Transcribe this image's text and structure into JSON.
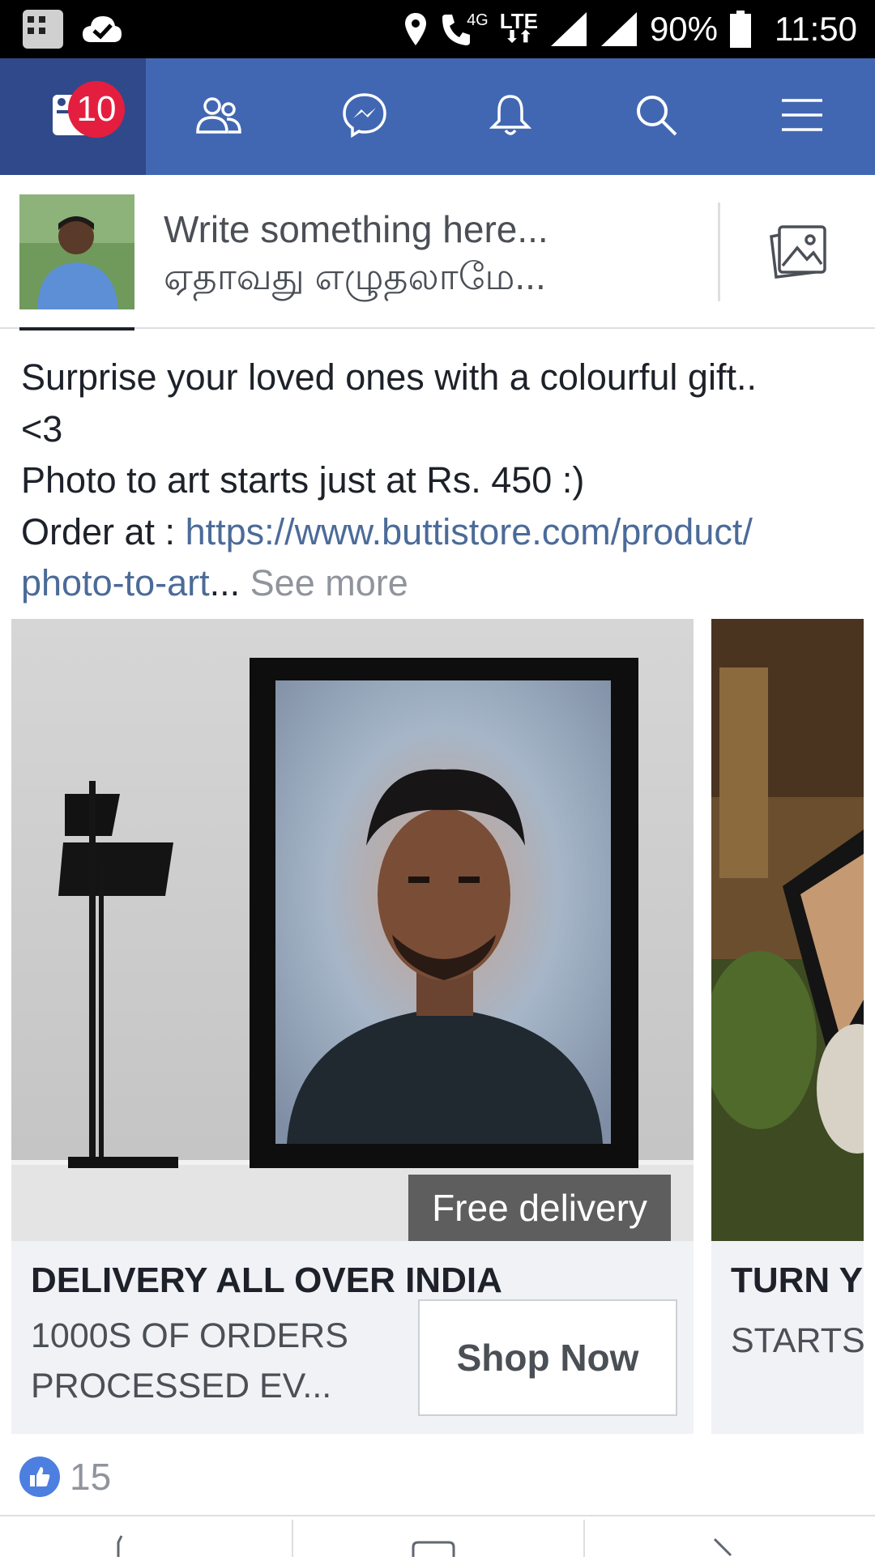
{
  "status_bar": {
    "network": "4G",
    "network_type": "LTE",
    "battery": "90%",
    "time": "11:50"
  },
  "nav": {
    "items": [
      {
        "icon": "news-feed-icon"
      },
      {
        "icon": "friends-icon"
      },
      {
        "icon": "messenger-icon"
      },
      {
        "icon": "bell-icon"
      },
      {
        "icon": "search-icon"
      },
      {
        "icon": "menu-icon"
      }
    ],
    "badge_count": "10"
  },
  "composer": {
    "line1": "Write something here...",
    "line2": "ஏதாவது எழுதலாமே..."
  },
  "post": {
    "line1": "Surprise your loved ones with a colourful gift..",
    "line2": "<3",
    "line3": "Photo to art starts just at Rs. 450 :)",
    "order_prefix": "Order at : ",
    "link_part1": "https://www.buttistore.com/product/",
    "link_part2": "photo-to-art",
    "ellipsis": "...",
    "see_more": "See more"
  },
  "carousel": [
    {
      "overlay": "Free delivery",
      "headline": "DELIVERY ALL OVER INDIA",
      "desc_line1": "1000S OF ORDERS",
      "desc_line2": "PROCESSED EV...",
      "cta": "Shop Now"
    },
    {
      "headline": "TURN Y",
      "desc_line1": "STARTS"
    }
  ],
  "reactions": {
    "count": "15"
  },
  "colors": {
    "brand": "#4267b2",
    "badge": "#e41e3f",
    "link": "#4b6b99"
  }
}
